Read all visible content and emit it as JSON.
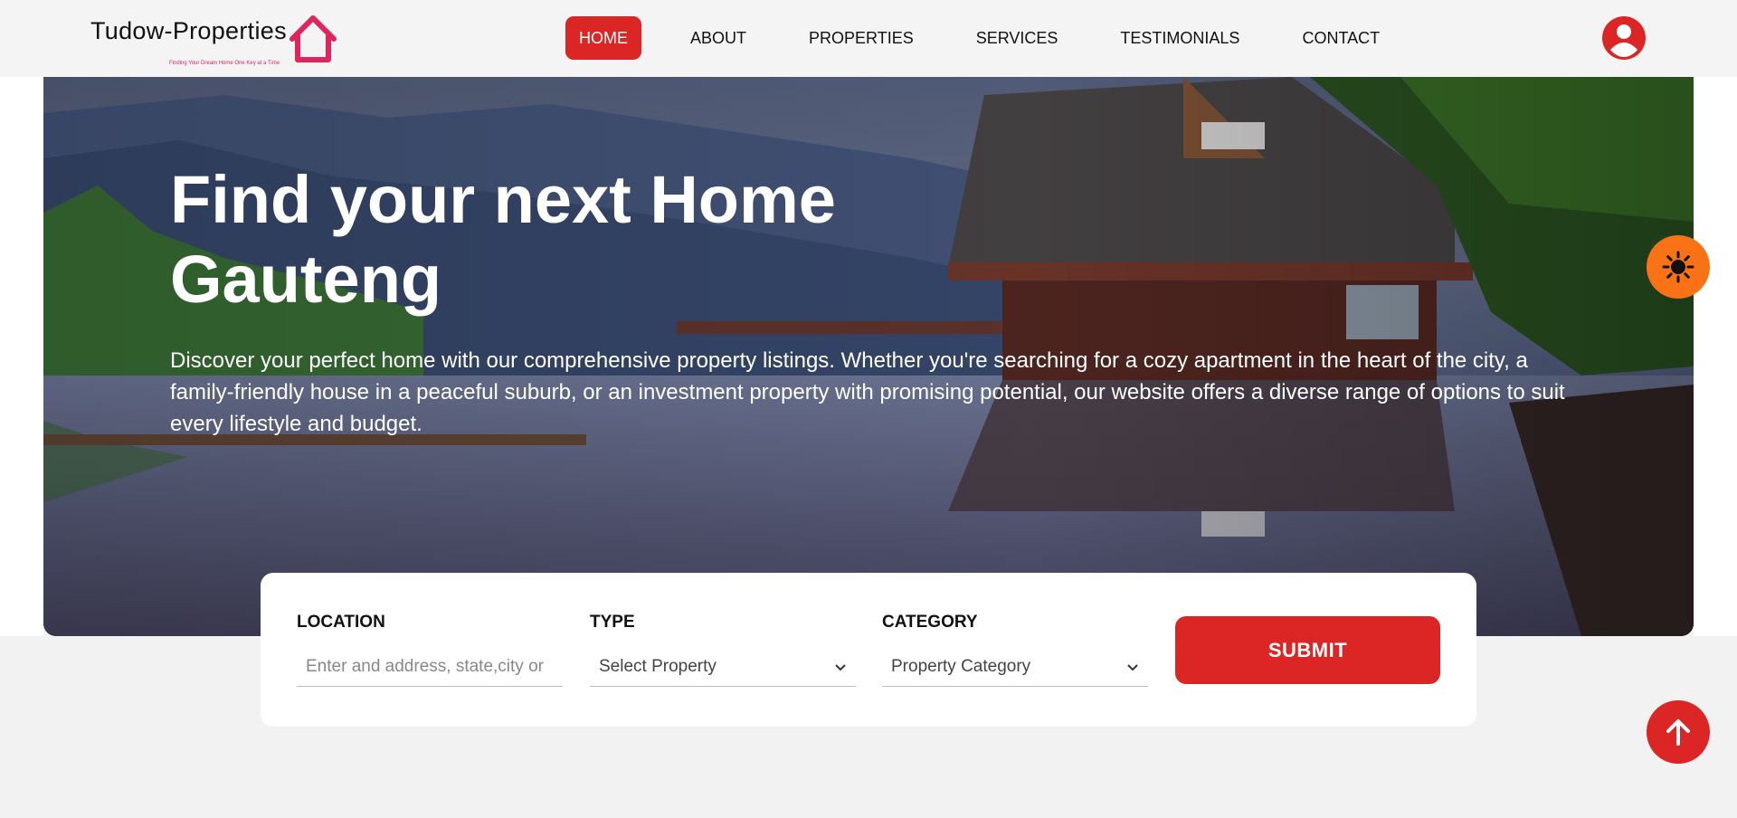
{
  "header": {
    "logo": {
      "name": "Tudow-Properties",
      "tagline": "Finding Your Dream Home One Key at a Time"
    },
    "nav": [
      {
        "label": "HOME",
        "active": true
      },
      {
        "label": "ABOUT"
      },
      {
        "label": "PROPERTIES"
      },
      {
        "label": "SERVICES"
      },
      {
        "label": "TESTIMONIALS"
      },
      {
        "label": "CONTACT"
      }
    ],
    "profile_icon": "user-circle-icon"
  },
  "hero": {
    "title_line1": "Find your next Home",
    "title_line2": "Gauteng",
    "description": "Discover your perfect home with our comprehensive property listings. Whether you're searching for a cozy apartment in the heart of the city, a family-friendly house in a peaceful suburb, or an investment property with promising potential, our website offers a diverse range of options to suit every lifestyle and budget."
  },
  "search": {
    "location": {
      "label": "LOCATION",
      "placeholder": "Enter and address, state,city or",
      "value": ""
    },
    "type": {
      "label": "TYPE",
      "selected": "Select Property"
    },
    "category": {
      "label": "CATEGORY",
      "selected": "Property Category"
    },
    "submit_label": "SUBMIT"
  },
  "floating": {
    "theme_icon": "sun-icon",
    "scroll_top_icon": "arrow-up-icon"
  },
  "colors": {
    "accent": "#dc2626",
    "theme_button": "#f97316",
    "logo_pink": "#e0245e",
    "background": "#f2f2f2"
  }
}
